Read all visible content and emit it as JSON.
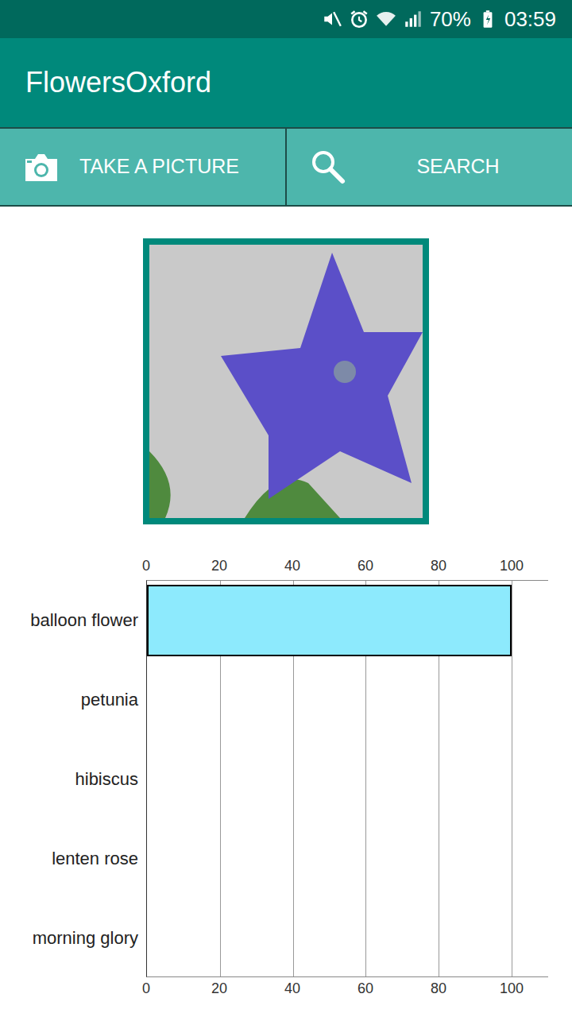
{
  "status_bar": {
    "battery": "70%",
    "time": "03:59"
  },
  "app_bar": {
    "title": "FlowersOxford"
  },
  "actions": [
    {
      "label": "TAKE A PICTURE"
    },
    {
      "label": "SEARCH"
    }
  ],
  "chart": {
    "ticks": [
      "0",
      "20",
      "40",
      "60",
      "80",
      "100"
    ],
    "axis_max": 110,
    "categories": [
      "balloon flower",
      "petunia",
      "hibiscus",
      "lenten rose",
      "morning glory"
    ],
    "values": [
      100,
      0,
      0,
      0,
      0
    ]
  }
}
